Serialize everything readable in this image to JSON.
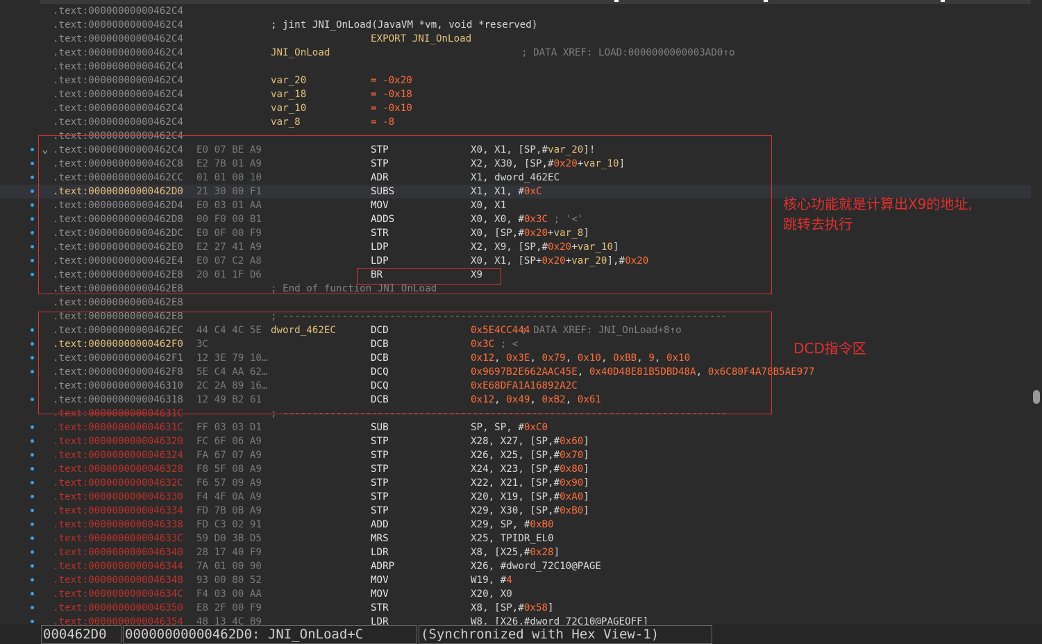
{
  "listing": [
    {
      "addr": ".text:00000000000462C4",
      "addr_color": "grey"
    },
    {
      "addr": ".text:00000000000462C4",
      "addr_color": "grey",
      "ops_plain": "; jint JNI_OnLoad(JavaVM *vm, void *reserved)"
    },
    {
      "addr": ".text:00000000000462C4",
      "addr_color": "grey",
      "export": "EXPORT JNI_OnLoad"
    },
    {
      "addr": ".text:00000000000462C4",
      "addr_color": "grey",
      "label": "JNI_OnLoad",
      "comment": "; DATA XREF: LOAD:0000000000003AD0↑o"
    },
    {
      "addr": ".text:00000000000462C4",
      "addr_color": "grey"
    },
    {
      "addr": ".text:00000000000462C4",
      "addr_color": "grey",
      "label": "var_20",
      "eq": "= -0x20"
    },
    {
      "addr": ".text:00000000000462C4",
      "addr_color": "grey",
      "label": "var_18",
      "eq": "= -0x18"
    },
    {
      "addr": ".text:00000000000462C4",
      "addr_color": "grey",
      "label": "var_10",
      "eq": "= -0x10"
    },
    {
      "addr": ".text:00000000000462C4",
      "addr_color": "grey",
      "label": "var_8",
      "eq": "= -8"
    },
    {
      "addr": ".text:00000000000462C4",
      "addr_color": "grey"
    },
    {
      "addr": ".text:00000000000462C4",
      "addr_color": "grey",
      "bytes": "E0 07 BE A9",
      "mn": "STP",
      "ops": [
        [
          "X0, X1, [SP,#",
          "p"
        ],
        [
          "var_20",
          "v"
        ],
        [
          "]!",
          "p"
        ]
      ],
      "dot": true,
      "chev": true
    },
    {
      "addr": ".text:00000000000462C8",
      "addr_color": "grey",
      "bytes": "E2 7B 01 A9",
      "mn": "STP",
      "ops": [
        [
          "X2, X30, [SP,#",
          "p"
        ],
        [
          "0x20",
          "n"
        ],
        [
          "+",
          "p"
        ],
        [
          "var_10",
          "v"
        ],
        [
          "]",
          "p"
        ]
      ],
      "dot": true
    },
    {
      "addr": ".text:00000000000462CC",
      "addr_color": "grey",
      "bytes": "01 01 00 10",
      "mn": "ADR",
      "ops": [
        [
          "X1, dword_462EC",
          "p"
        ]
      ],
      "dot": true
    },
    {
      "addr": ".text:00000000000462D0",
      "addr_color": "yellow",
      "bytes": "21 30 00 F1",
      "mn": "SUBS",
      "ops": [
        [
          "X1, X1, #",
          "p"
        ],
        [
          "0xC",
          "n"
        ]
      ],
      "dot": true,
      "hl": true
    },
    {
      "addr": ".text:00000000000462D4",
      "addr_color": "grey",
      "bytes": "E0 03 01 AA",
      "mn": "MOV",
      "ops": [
        [
          "X0, X1",
          "p"
        ]
      ],
      "dot": true
    },
    {
      "addr": ".text:00000000000462D8",
      "addr_color": "grey",
      "bytes": "00 F0 00 B1",
      "mn": "ADDS",
      "ops": [
        [
          "X0, X0, #",
          "p"
        ],
        [
          "0x3C",
          "n"
        ],
        [
          " ; '<'",
          "c"
        ]
      ],
      "dot": true
    },
    {
      "addr": ".text:00000000000462DC",
      "addr_color": "grey",
      "bytes": "E0 0F 00 F9",
      "mn": "STR",
      "ops": [
        [
          "X0, [SP,#",
          "p"
        ],
        [
          "0x20",
          "n"
        ],
        [
          "+",
          "p"
        ],
        [
          "var_8",
          "v"
        ],
        [
          "]",
          "p"
        ]
      ],
      "dot": true
    },
    {
      "addr": ".text:00000000000462E0",
      "addr_color": "grey",
      "bytes": "E2 27 41 A9",
      "mn": "LDP",
      "ops": [
        [
          "X2, X9, [SP,#",
          "p"
        ],
        [
          "0x20",
          "n"
        ],
        [
          "+",
          "p"
        ],
        [
          "var_10",
          "v"
        ],
        [
          "]",
          "p"
        ]
      ],
      "dot": true
    },
    {
      "addr": ".text:00000000000462E4",
      "addr_color": "grey",
      "bytes": "E0 07 C2 A8",
      "mn": "LDP",
      "ops": [
        [
          "X0, X1, [SP+",
          "p"
        ],
        [
          "0x20",
          "n"
        ],
        [
          "+",
          "p"
        ],
        [
          "var_20",
          "v"
        ],
        [
          "],#",
          "p"
        ],
        [
          "0x20",
          "n"
        ]
      ],
      "dot": true
    },
    {
      "addr": ".text:00000000000462E8",
      "addr_color": "grey",
      "bytes": "20 01 1F D6",
      "mn": "BR",
      "ops": [
        [
          "X9",
          "p"
        ]
      ],
      "dot": true
    },
    {
      "addr": ".text:00000000000462E8",
      "addr_color": "grey",
      "ops_plain": "; End of function JNI_OnLoad",
      "plain_cmt": true
    },
    {
      "addr": ".text:00000000000462E8",
      "addr_color": "grey"
    },
    {
      "addr": ".text:00000000000462E8",
      "addr_color": "grey",
      "ops_plain": "; ---------------------------------------------------------------------------",
      "plain_cmt": true
    },
    {
      "addr": ".text:00000000000462EC",
      "addr_color": "grey",
      "bytes": "44 C4 4C 5E",
      "label": "dword_462EC",
      "mn": "DCD",
      "ops": [
        [
          "0x5E4CC444",
          "n"
        ]
      ],
      "comment": "; DATA XREF: JNI_OnLoad+8↑o",
      "dot": true
    },
    {
      "addr": ".text:00000000000462F0",
      "addr_color": "yellow",
      "bytes": "3C",
      "mn": "DCB",
      "ops": [
        [
          "0x3C",
          "n"
        ],
        [
          " ; <",
          "c"
        ]
      ],
      "dot": true
    },
    {
      "addr": ".text:00000000000462F1",
      "addr_color": "grey",
      "bytes": "12 3E 79 10…",
      "mn": "DCB",
      "ops": [
        [
          "0x12",
          "n"
        ],
        [
          ", ",
          "p"
        ],
        [
          "0x3E",
          "n"
        ],
        [
          ", ",
          "p"
        ],
        [
          "0x79",
          "n"
        ],
        [
          ", ",
          "p"
        ],
        [
          "0x10",
          "n"
        ],
        [
          ", ",
          "p"
        ],
        [
          "0xBB",
          "n"
        ],
        [
          ", ",
          "p"
        ],
        [
          "9",
          "n"
        ],
        [
          ", ",
          "p"
        ],
        [
          "0x10",
          "n"
        ]
      ],
      "dot": true
    },
    {
      "addr": ".text:00000000000462F8",
      "addr_color": "grey",
      "bytes": "5E C4 AA 62…",
      "mn": "DCQ",
      "ops": [
        [
          "0x9697B2E662AAC45E",
          "n"
        ],
        [
          ", ",
          "p"
        ],
        [
          "0x40D48E81B5DBD48A",
          "n"
        ],
        [
          ", ",
          "p"
        ],
        [
          "0x6C80F4A78B5AE977",
          "n"
        ]
      ],
      "dot": true
    },
    {
      "addr": ".text:0000000000046310",
      "addr_color": "grey",
      "bytes": "2C 2A 89 16…",
      "mn": "DCQ",
      "ops": [
        [
          "0xE68DFA1A16892A2C",
          "n"
        ]
      ],
      "dot": false
    },
    {
      "addr": ".text:0000000000046318",
      "addr_color": "grey",
      "bytes": "12 49 B2 61",
      "mn": "DCB",
      "ops": [
        [
          "0x12",
          "n"
        ],
        [
          ", ",
          "p"
        ],
        [
          "0x49",
          "n"
        ],
        [
          ", ",
          "p"
        ],
        [
          "0xB2",
          "n"
        ],
        [
          ", ",
          "p"
        ],
        [
          "0x61",
          "n"
        ]
      ],
      "dot": true
    },
    {
      "addr": ".text:000000000004631C",
      "addr_color": "red",
      "ops_plain": "; ---------------------------------------------------------------------------",
      "plain_cmt": true
    },
    {
      "addr": ".text:000000000004631C",
      "addr_color": "red",
      "bytes": "FF 03 03 D1",
      "mn": "SUB",
      "ops": [
        [
          "SP, SP, #",
          "p"
        ],
        [
          "0xC0",
          "n"
        ]
      ],
      "dot": true
    },
    {
      "addr": ".text:0000000000046320",
      "addr_color": "red",
      "bytes": "FC 6F 06 A9",
      "mn": "STP",
      "ops": [
        [
          "X28, X27, [SP,#",
          "p"
        ],
        [
          "0x60",
          "n"
        ],
        [
          "]",
          "p"
        ]
      ],
      "dot": true
    },
    {
      "addr": ".text:0000000000046324",
      "addr_color": "red",
      "bytes": "FA 67 07 A9",
      "mn": "STP",
      "ops": [
        [
          "X26, X25, [SP,#",
          "p"
        ],
        [
          "0x70",
          "n"
        ],
        [
          "]",
          "p"
        ]
      ],
      "dot": true
    },
    {
      "addr": ".text:0000000000046328",
      "addr_color": "red",
      "bytes": "F8 5F 08 A9",
      "mn": "STP",
      "ops": [
        [
          "X24, X23, [SP,#",
          "p"
        ],
        [
          "0x80",
          "n"
        ],
        [
          "]",
          "p"
        ]
      ],
      "dot": true
    },
    {
      "addr": ".text:000000000004632C",
      "addr_color": "red",
      "bytes": "F6 57 09 A9",
      "mn": "STP",
      "ops": [
        [
          "X22, X21, [SP,#",
          "p"
        ],
        [
          "0x90",
          "n"
        ],
        [
          "]",
          "p"
        ]
      ],
      "dot": true
    },
    {
      "addr": ".text:0000000000046330",
      "addr_color": "red",
      "bytes": "F4 4F 0A A9",
      "mn": "STP",
      "ops": [
        [
          "X20, X19, [SP,#",
          "p"
        ],
        [
          "0xA0",
          "n"
        ],
        [
          "]",
          "p"
        ]
      ],
      "dot": true
    },
    {
      "addr": ".text:0000000000046334",
      "addr_color": "red",
      "bytes": "FD 7B 0B A9",
      "mn": "STP",
      "ops": [
        [
          "X29, X30, [SP,#",
          "p"
        ],
        [
          "0xB0",
          "n"
        ],
        [
          "]",
          "p"
        ]
      ],
      "dot": true
    },
    {
      "addr": ".text:0000000000046338",
      "addr_color": "red",
      "bytes": "FD C3 02 91",
      "mn": "ADD",
      "ops": [
        [
          "X29, SP, #",
          "p"
        ],
        [
          "0xB0",
          "n"
        ]
      ],
      "dot": true
    },
    {
      "addr": ".text:000000000004633C",
      "addr_color": "red",
      "bytes": "59 D0 3B D5",
      "mn": "MRS",
      "ops": [
        [
          "X25, TPIDR_EL0",
          "p"
        ]
      ],
      "dot": true
    },
    {
      "addr": ".text:0000000000046340",
      "addr_color": "red",
      "bytes": "28 17 40 F9",
      "mn": "LDR",
      "ops": [
        [
          "X8, [X25,#",
          "p"
        ],
        [
          "0x28",
          "n"
        ],
        [
          "]",
          "p"
        ]
      ],
      "dot": true
    },
    {
      "addr": ".text:0000000000046344",
      "addr_color": "red",
      "bytes": "7A 01 00 90",
      "mn": "ADRP",
      "ops": [
        [
          "X26, #dword_72C10@PAGE",
          "p"
        ]
      ],
      "dot": true
    },
    {
      "addr": ".text:0000000000046348",
      "addr_color": "red",
      "bytes": "93 00 80 52",
      "mn": "MOV",
      "ops": [
        [
          "W19, #",
          "p"
        ],
        [
          "4",
          "n"
        ]
      ],
      "dot": true
    },
    {
      "addr": ".text:000000000004634C",
      "addr_color": "red",
      "bytes": "F4 03 00 AA",
      "mn": "MOV",
      "ops": [
        [
          "X20, X0",
          "p"
        ]
      ],
      "dot": true
    },
    {
      "addr": ".text:0000000000046350",
      "addr_color": "red",
      "bytes": "E8 2F 00 F9",
      "mn": "STR",
      "ops": [
        [
          "X8, [SP,#",
          "p"
        ],
        [
          "0x58",
          "n"
        ],
        [
          "]",
          "p"
        ]
      ],
      "dot": true
    },
    {
      "addr": ".text:0000000000046354",
      "addr_color": "red",
      "bytes": "48 13 4C B9",
      "mn": "LDR",
      "ops": [
        [
          "W8, [X26,#dword_72C10@PAGEOFF]",
          "p"
        ]
      ],
      "dot": true
    }
  ],
  "annotations": {
    "core_line1": "核心功能就是计算出X9的地址,",
    "core_line2": "跳转去执行",
    "dcd_label": "DCD指令区"
  },
  "statusbar": {
    "addr": "000462D0",
    "location": "00000000000462D0: JNI_OnLoad+C",
    "sync": "(Synchronized with Hex View-1)"
  },
  "colors": {
    "background": "#2b2b2b",
    "address_grey": "#8c8c8c",
    "address_yellow": "#e5c07b",
    "address_red": "#c0302a",
    "number_orange": "#ff6e3a",
    "annotation_red": "#e03030",
    "breakpoint_dot": "#3ea0e6"
  }
}
